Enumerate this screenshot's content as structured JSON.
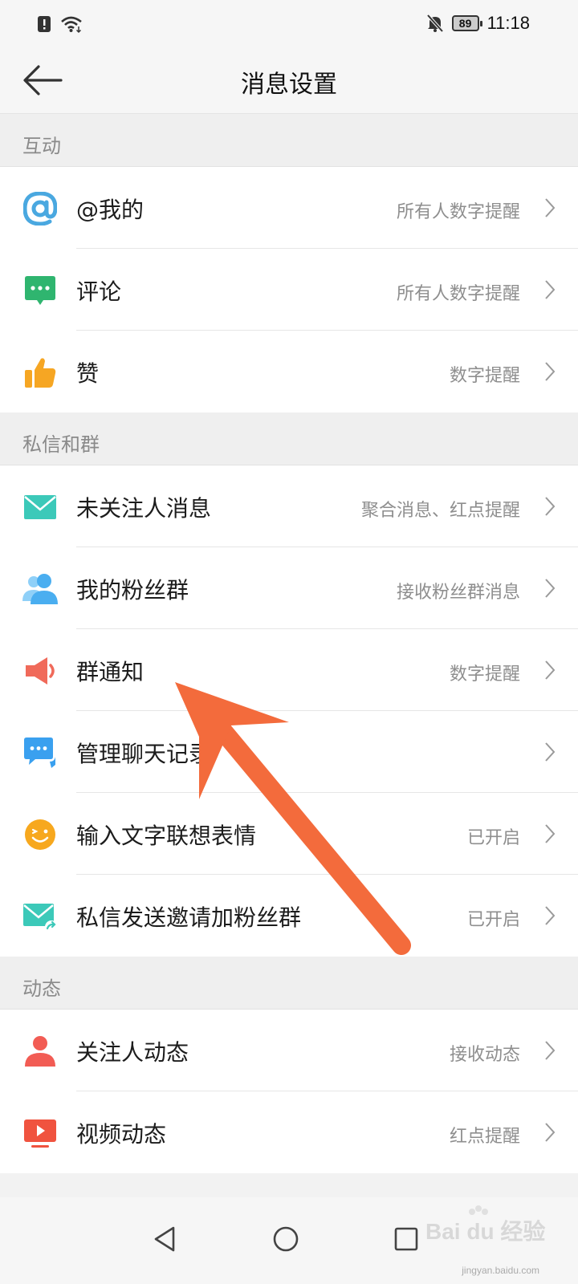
{
  "status_bar": {
    "time": "11:18",
    "battery": "89",
    "icons": [
      "alert-icon",
      "wifi-icon",
      "mute-bell-icon",
      "battery-icon"
    ]
  },
  "header": {
    "title": "消息设置"
  },
  "sections": [
    {
      "title": "互动",
      "items": [
        {
          "label": "@我的",
          "value": "所有人数字提醒",
          "icon": "at-icon",
          "color": "#4aa8e0"
        },
        {
          "label": "评论",
          "value": "所有人数字提醒",
          "icon": "comment-icon",
          "color": "#2fb56f"
        },
        {
          "label": "赞",
          "value": "数字提醒",
          "icon": "thumb-up-icon",
          "color": "#f6a623"
        }
      ]
    },
    {
      "title": "私信和群",
      "items": [
        {
          "label": "未关注人消息",
          "value": "聚合消息、红点提醒",
          "icon": "envelope-icon",
          "color": "#3cc9b9"
        },
        {
          "label": "我的粉丝群",
          "value": "接收粉丝群消息",
          "icon": "group-icon",
          "color": "#4aaef0"
        },
        {
          "label": "群通知",
          "value": "数字提醒",
          "icon": "megaphone-icon",
          "color": "#f06a5a"
        },
        {
          "label": "管理聊天记录",
          "value": "",
          "icon": "chat-manage-icon",
          "color": "#3aa0ef"
        },
        {
          "label": "输入文字联想表情",
          "value": "已开启",
          "icon": "smiley-icon",
          "color": "#f7a81e"
        },
        {
          "label": "私信发送邀请加粉丝群",
          "value": "已开启",
          "icon": "envelope-share-icon",
          "color": "#3cc9b9"
        }
      ]
    },
    {
      "title": "动态",
      "items": [
        {
          "label": "关注人动态",
          "value": "接收动态",
          "icon": "person-icon",
          "color": "#f25c54"
        },
        {
          "label": "视频动态",
          "value": "红点提醒",
          "icon": "video-play-icon",
          "color": "#f0533f"
        }
      ]
    }
  ],
  "nav_bar": {
    "icons": [
      "back-triangle-icon",
      "home-circle-icon",
      "recents-square-icon"
    ]
  },
  "watermark": {
    "logo": "Bai du 经验",
    "url": "jingyan.baidu.com"
  },
  "annotation": {
    "color": "#f36b3c"
  }
}
